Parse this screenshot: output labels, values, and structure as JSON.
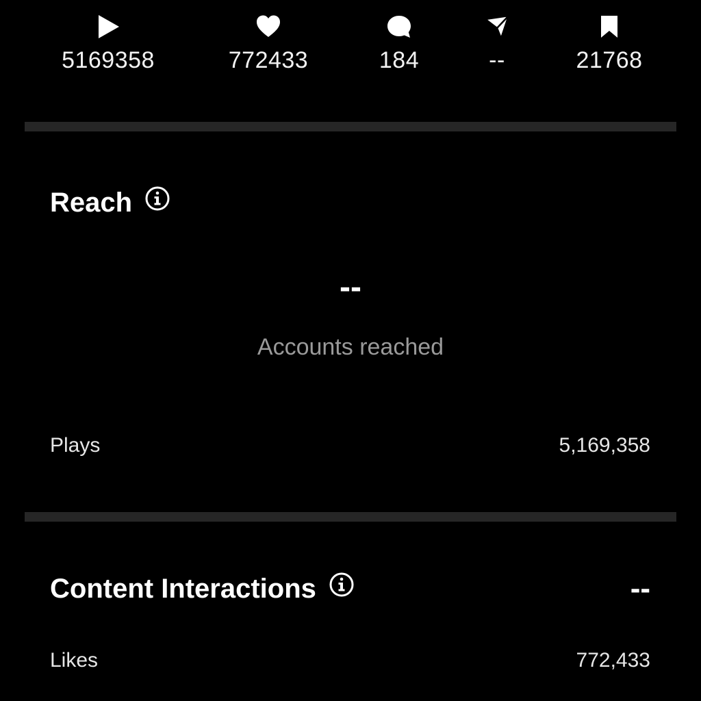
{
  "stats": {
    "plays": {
      "icon": "play-icon",
      "value": "5169358"
    },
    "likes": {
      "icon": "heart-icon",
      "value": "772433"
    },
    "comments": {
      "icon": "comment-icon",
      "value": "184"
    },
    "shares": {
      "icon": "send-icon",
      "value": "--"
    },
    "saves": {
      "icon": "bookmark-icon",
      "value": "21768"
    }
  },
  "reach": {
    "title": "Reach",
    "accounts_reached_value": "--",
    "accounts_reached_label": "Accounts reached",
    "plays_label": "Plays",
    "plays_value": "5,169,358"
  },
  "content_interactions": {
    "title": "Content Interactions",
    "total_value": "--",
    "likes_label": "Likes",
    "likes_value": "772,433"
  },
  "colors": {
    "background": "#000000",
    "divider": "#262626",
    "secondary_text": "#9a9a9a"
  }
}
